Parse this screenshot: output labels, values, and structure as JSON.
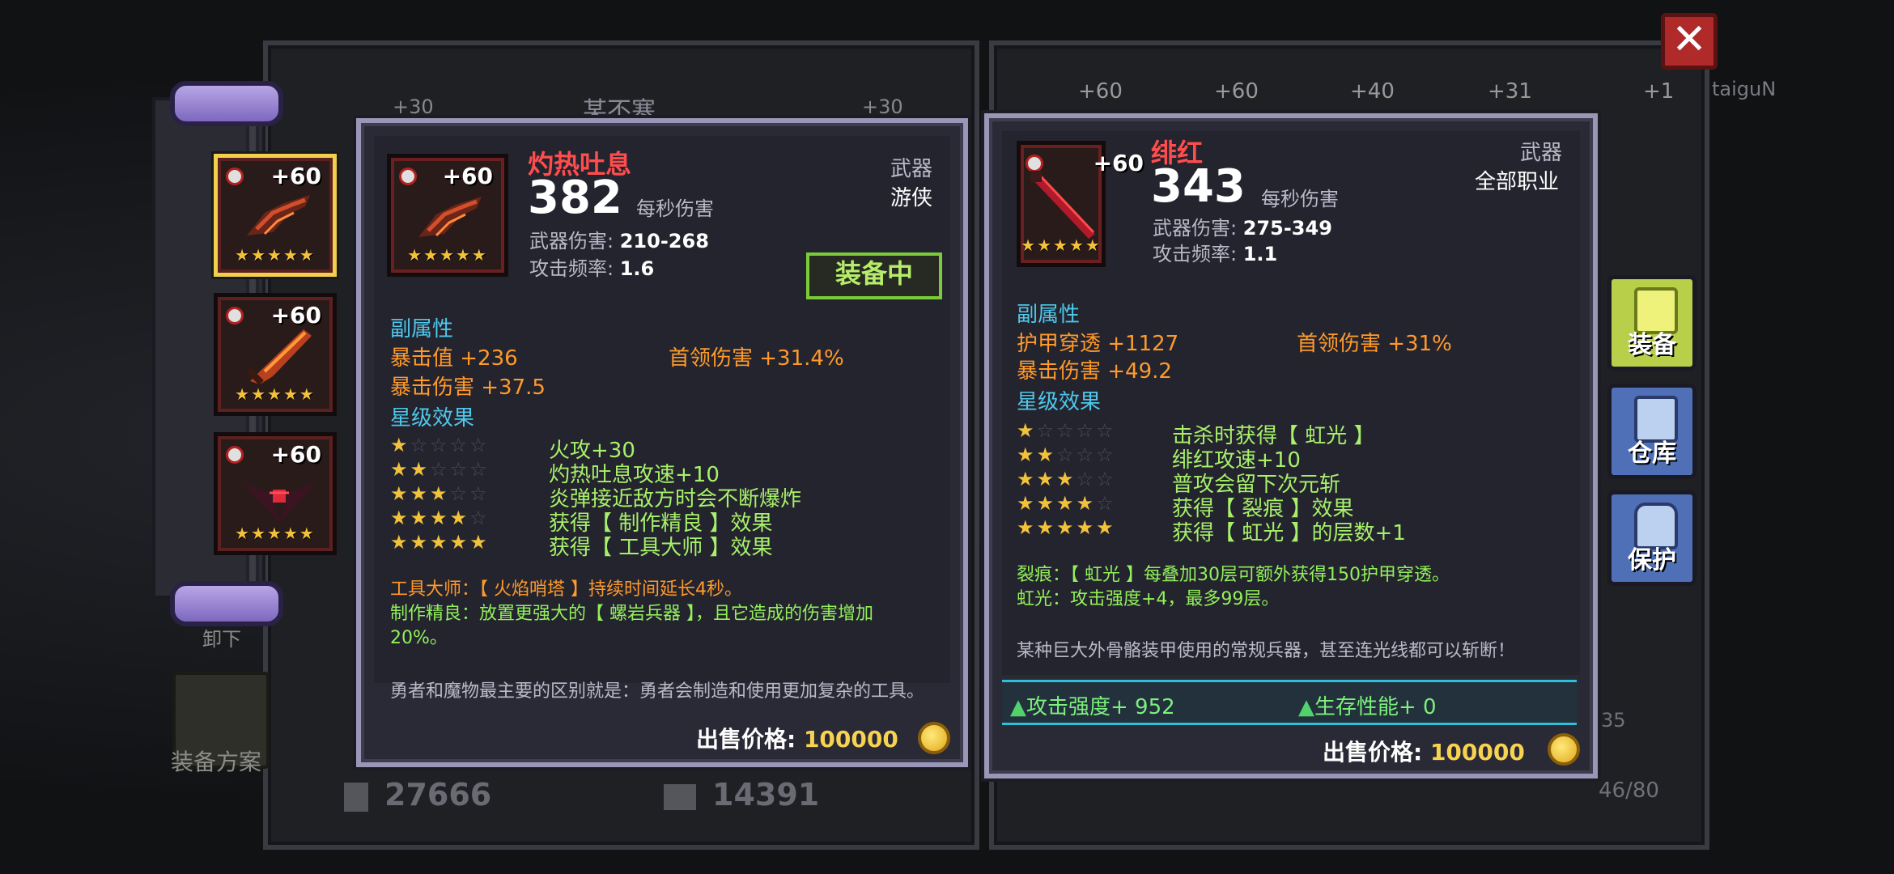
{
  "background": {
    "left_panel_title": "某不寒",
    "left_bottom_stats": [
      "27666",
      "14391"
    ],
    "left_tab_tops": [
      "+30",
      "+30"
    ],
    "right_tab_tops": [
      "+60",
      "+60",
      "+40",
      "+31",
      "+1"
    ],
    "right_side_name": "taiguN",
    "inventory_count": "46/80",
    "inventory_side_num": "35",
    "equip_plan_label": "装备方案",
    "unequip_label": "卸下"
  },
  "left_items": [
    {
      "level": "+60",
      "stars": "★★★★★",
      "selected": true
    },
    {
      "level": "+60",
      "stars": "★★★★★",
      "selected": false
    },
    {
      "level": "+60",
      "stars": "★★★★★",
      "selected": false
    }
  ],
  "card_left": {
    "name": "灼热吐息",
    "level": "+60",
    "icon_stars": "★★★★★",
    "dps": "382",
    "dps_label": "每秒伤害",
    "damage_label": "武器伤害:",
    "damage_value": "210-268",
    "speed_label": "攻击频率:",
    "speed_value": "1.6",
    "type": "武器",
    "class": "游侠",
    "equipped_label": "装备中",
    "substats_title": "副属性",
    "substats": [
      {
        "text": "暴击值 +236"
      },
      {
        "text": "首领伤害 +31.4%"
      },
      {
        "text": "暴击伤害 +37.5"
      }
    ],
    "star_effects_title": "星级效果",
    "star_effects": [
      {
        "on": "★",
        "off": "☆☆☆☆",
        "text": "火攻+30"
      },
      {
        "on": "★★",
        "off": "☆☆☆",
        "text": "灼热吐息攻速+10"
      },
      {
        "on": "★★★",
        "off": "☆☆",
        "text": "炎弹接近敌方时会不断爆炸"
      },
      {
        "on": "★★★★",
        "off": "☆",
        "text": "获得【 制作精良 】效果"
      },
      {
        "on": "★★★★★",
        "off": "",
        "text": "获得【 工具大师 】效果"
      }
    ],
    "note1": "工具大师：【 火焰哨塔 】持续时间延长4秒。",
    "note2_line1": "制作精良：放置更强大的【 螺岩兵器 】，且它造成的伤害增加",
    "note2_line2": "20%。",
    "flavor": "勇者和魔物最主要的区别就是：勇者会制造和使用更加复杂的工具。",
    "price_label": "出售价格:",
    "price_value": "100000"
  },
  "card_right": {
    "name": "绯红",
    "level": "+60",
    "icon_stars": "★★★★★",
    "dps": "343",
    "dps_label": "每秒伤害",
    "damage_label": "武器伤害:",
    "damage_value": "275-349",
    "speed_label": "攻击频率:",
    "speed_value": "1.1",
    "type": "武器",
    "class": "全部职业",
    "substats_title": "副属性",
    "substats": [
      {
        "text": "护甲穿透 +1127"
      },
      {
        "text": "首领伤害 +31%"
      },
      {
        "text": "暴击伤害 +49.2"
      }
    ],
    "star_effects_title": "星级效果",
    "star_effects": [
      {
        "on": "★",
        "off": "☆☆☆☆",
        "text": "击杀时获得【 虹光 】"
      },
      {
        "on": "★★",
        "off": "☆☆☆",
        "text": "绯红攻速+10"
      },
      {
        "on": "★★★",
        "off": "☆☆",
        "text": "普攻会留下次元斩"
      },
      {
        "on": "★★★★",
        "off": "☆",
        "text": "获得【 裂痕 】效果"
      },
      {
        "on": "★★★★★",
        "off": "",
        "text": "获得【 虹光 】的层数+1"
      }
    ],
    "note1": "裂痕：【 虹光 】每叠加30层可额外获得150护甲穿透。",
    "note2": "虹光：攻击强度+4，最多99层。",
    "flavor": "某种巨大外骨骼装甲使用的常规兵器，甚至连光线都可以斩断！",
    "compare_attack": "攻击强度+ 952",
    "compare_survival": "生存性能+ 0",
    "price_label": "出售价格:",
    "price_value": "100000"
  },
  "side_tabs": [
    {
      "label": "装备",
      "color": "#b8cf4a"
    },
    {
      "label": "仓库",
      "color": "#4f6fb6"
    },
    {
      "label": "保护",
      "color": "#4f6fb6"
    }
  ],
  "close_label": "✕"
}
